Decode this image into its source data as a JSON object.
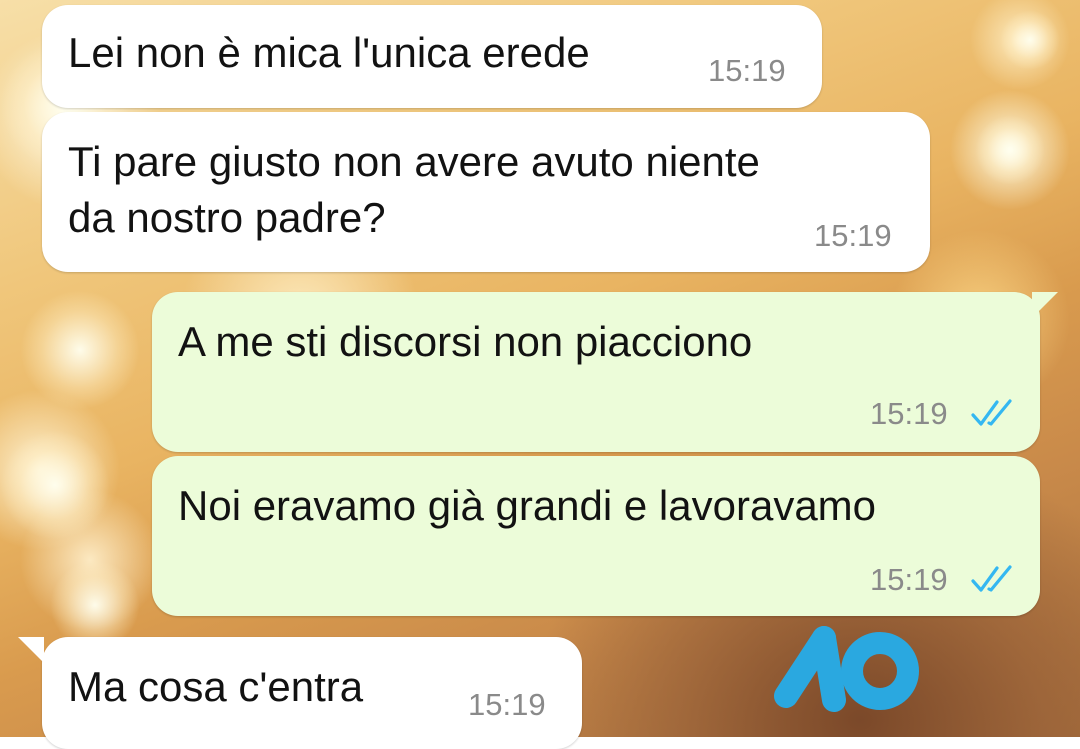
{
  "chat": {
    "messages": [
      {
        "direction": "incoming",
        "text": "Lei non è mica l'unica erede",
        "time": "15:19"
      },
      {
        "direction": "incoming",
        "text": "Ti pare giusto non avere avuto niente\nda nostro padre?",
        "time": "15:19"
      },
      {
        "direction": "outgoing",
        "text": "A me sti discorsi non piacciono",
        "time": "15:19",
        "status": "read"
      },
      {
        "direction": "outgoing",
        "text": "Noi eravamo già grandi e lavoravamo",
        "time": "15:19",
        "status": "read"
      },
      {
        "direction": "incoming",
        "text": "Ma cosa c'entra",
        "time": "15:19"
      }
    ]
  },
  "watermark": {
    "icon": "logo-10-icon",
    "text": "10"
  },
  "colors": {
    "incoming_bubble": "#ffffff",
    "outgoing_bubble": "#ecfcd9",
    "read_ticks": "#34b7f1",
    "time_text": "#8a8a8a",
    "logo": "#2aa8e0"
  }
}
